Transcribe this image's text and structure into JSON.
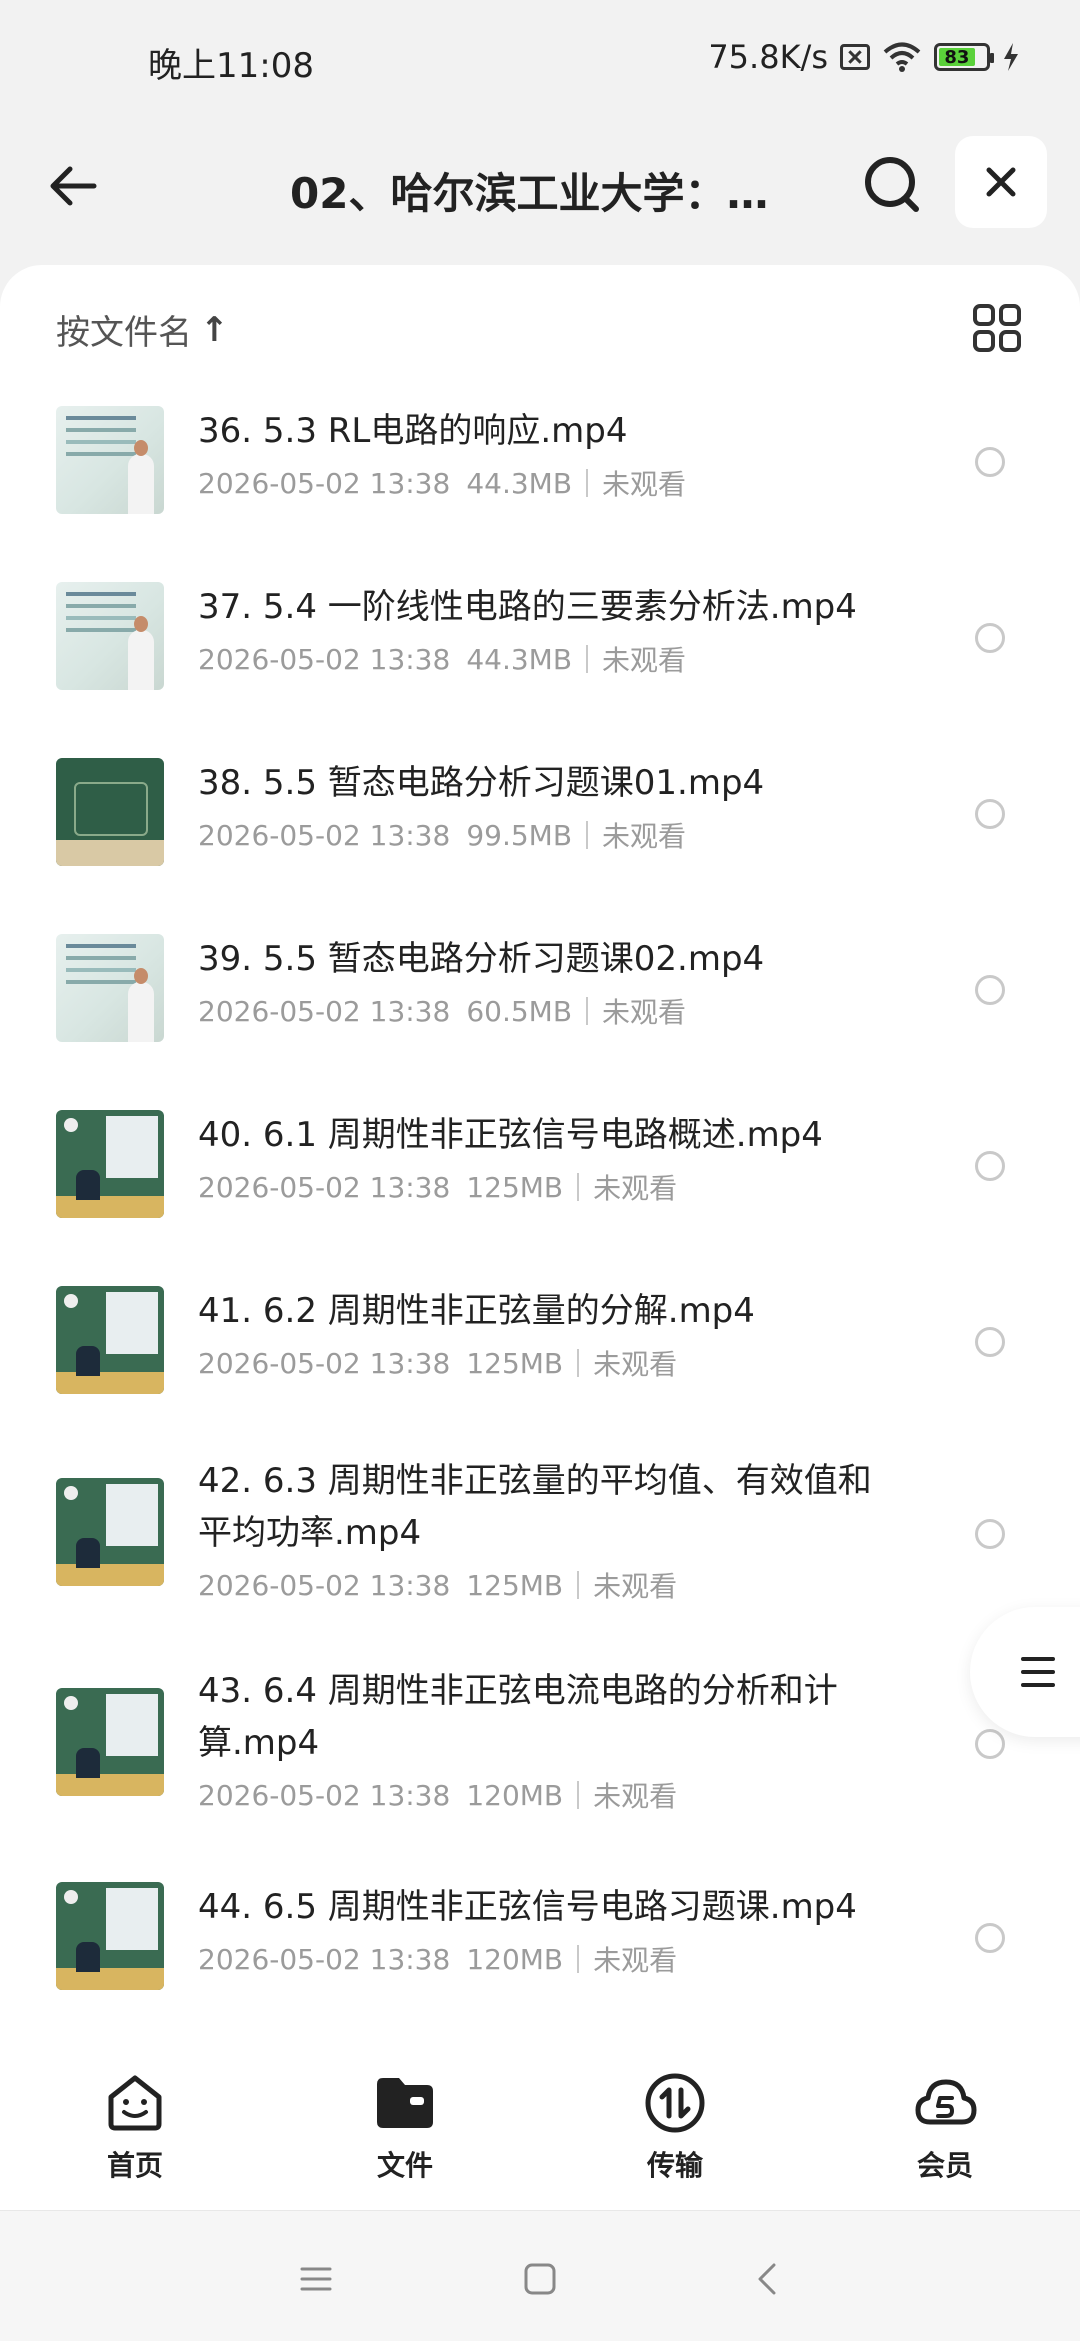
{
  "status_bar": {
    "time": "晚上11:08",
    "speed": "75.8K/s",
    "battery": "83",
    "icons": [
      "no-sim-icon",
      "wifi-icon",
      "battery-icon",
      "charging-icon"
    ]
  },
  "header": {
    "title": "02、哈尔滨工业大学：...",
    "icons": [
      "back-arrow-icon",
      "search-icon",
      "close-icon"
    ]
  },
  "sort": {
    "label": "按文件名",
    "arrow": "↑"
  },
  "files": [
    {
      "name": "36. 5.3 RL电路的响应.mp4",
      "date": "2026-05-02 13:38",
      "size": "44.3MB",
      "status": "未观看"
    },
    {
      "name": "37. 5.4 一阶线性电路的三要素分析法.mp4",
      "date": "2026-05-02 13:38",
      "size": "44.3MB",
      "status": "未观看"
    },
    {
      "name": "38. 5.5 暂态电路分析习题课01.mp4",
      "date": "2026-05-02 13:38",
      "size": "99.5MB",
      "status": "未观看"
    },
    {
      "name": "39. 5.5 暂态电路分析习题课02.mp4",
      "date": "2026-05-02 13:38",
      "size": "60.5MB",
      "status": "未观看"
    },
    {
      "name": "40. 6.1 周期性非正弦信号电路概述.mp4",
      "date": "2026-05-02 13:38",
      "size": "125MB",
      "status": "未观看"
    },
    {
      "name": "41. 6.2 周期性非正弦量的分解.mp4",
      "date": "2026-05-02 13:38",
      "size": "125MB",
      "status": "未观看"
    },
    {
      "name": "42. 6.3 周期性非正弦量的平均值、有效值和平均功率.mp4",
      "date": "2026-05-02 13:38",
      "size": "125MB",
      "status": "未观看"
    },
    {
      "name": "43. 6.4 周期性非正弦电流电路的分析和计算.mp4",
      "date": "2026-05-02 13:38",
      "size": "120MB",
      "status": "未观看"
    },
    {
      "name": "44. 6.5 周期性非正弦信号电路习题课.mp4",
      "date": "2026-05-02 13:38",
      "size": "120MB",
      "status": "未观看"
    }
  ],
  "nav": [
    {
      "label": "首页",
      "icon": "home-face-icon"
    },
    {
      "label": "文件",
      "icon": "folder-icon"
    },
    {
      "label": "传输",
      "icon": "transfer-icon"
    },
    {
      "label": "会员",
      "icon": "vip-cloud-icon"
    }
  ],
  "colors": {
    "accent_battery": "#5ad13a",
    "meta_gray": "#9b9b9b"
  }
}
